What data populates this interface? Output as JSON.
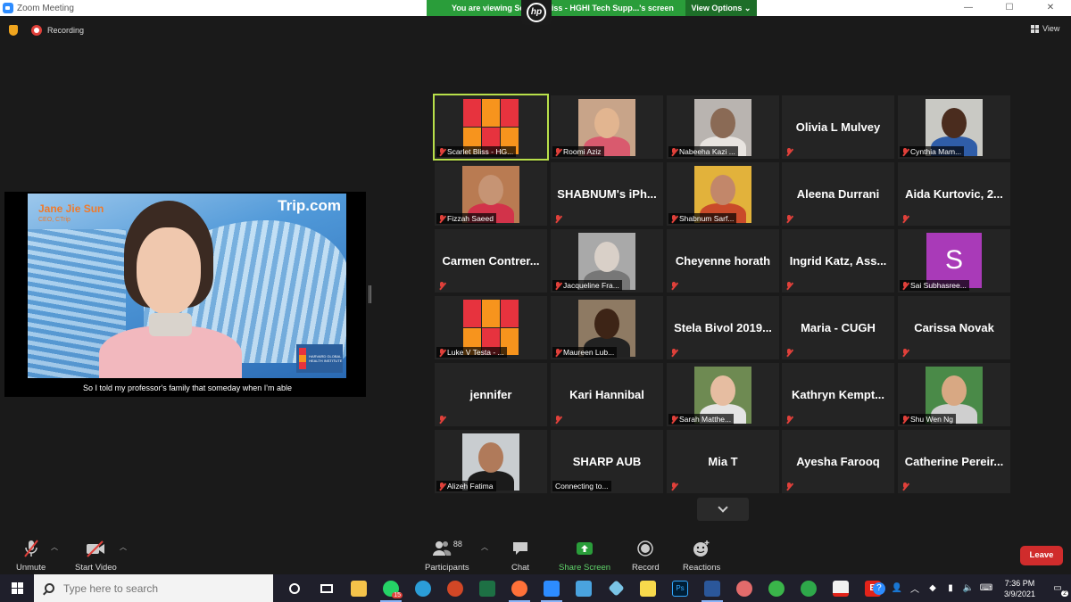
{
  "window": {
    "title": "Zoom Meeting"
  },
  "share_bar": {
    "message": "You are viewing Scarlet Bliss - HGHI Tech Supp...'s screen",
    "view_options": "View Options"
  },
  "window_controls": {
    "minimize": "—",
    "maximize": "☐",
    "close": "✕"
  },
  "recording": {
    "label": "Recording"
  },
  "view": {
    "label": "View"
  },
  "shared_screen": {
    "speaker_name": "Jane Jie Sun",
    "speaker_role": "CEO, CTrip",
    "brand": "Trip.com",
    "hghi_text": "HARVARD GLOBAL HEALTH INSTITUTE",
    "caption": "So I told my professor's family that someday when I'm able"
  },
  "participants": [
    {
      "name": "Scarlet Bliss - HG...",
      "kind": "logo",
      "active": true
    },
    {
      "name": "Roomi Aziz",
      "kind": "video",
      "bg": "#c8a489",
      "skin": "#e2b590",
      "top": "#d95a6e"
    },
    {
      "name": "Nabeeha Kazi ...",
      "kind": "video",
      "bg": "#b9b4b0",
      "skin": "#8a6a55",
      "top": "#e8e4e0"
    },
    {
      "name": "Olivia L Mulvey",
      "kind": "name"
    },
    {
      "name": "Cynthia Mam...",
      "kind": "video",
      "bg": "#c9c9c4",
      "skin": "#4a2c1e",
      "top": "#2f5da8"
    },
    {
      "name": "Fizzah Saeed",
      "kind": "video",
      "bg": "#b97b52",
      "skin": "#c69474",
      "top": "#d2334a"
    },
    {
      "name": "SHABNUM's iPh...",
      "kind": "name"
    },
    {
      "name": "Shabnum Sarf...",
      "kind": "video",
      "bg": "#e2b23b",
      "skin": "#c2876a",
      "top": "#c94a2a"
    },
    {
      "name": "Aleena Durrani",
      "kind": "name"
    },
    {
      "name": "Aida Kurtovic, 2...",
      "kind": "name"
    },
    {
      "name": "Carmen Contrer...",
      "kind": "name"
    },
    {
      "name": "Jacqueline Fra...",
      "kind": "video",
      "bg": "#a9a9a9",
      "skin": "#d9d0c8",
      "top": "#777777"
    },
    {
      "name": "Cheyenne horath",
      "kind": "name"
    },
    {
      "name": "Ingrid Katz, Ass...",
      "kind": "name"
    },
    {
      "name": "Sai Subhasree...",
      "kind": "avatar",
      "letter": "S"
    },
    {
      "name": "Luke V Testa - ...",
      "kind": "logo"
    },
    {
      "name": "Maureen Lub...",
      "kind": "video",
      "bg": "#8e7a63",
      "skin": "#3d2416",
      "top": "#222222"
    },
    {
      "name": "Stela Bivol 2019...",
      "kind": "name"
    },
    {
      "name": "Maria - CUGH",
      "kind": "name"
    },
    {
      "name": "Carissa Novak",
      "kind": "name"
    },
    {
      "name": "jennifer",
      "kind": "name"
    },
    {
      "name": "Kari Hannibal",
      "kind": "name"
    },
    {
      "name": "Sarah Matthe...",
      "kind": "video",
      "bg": "#6e8a52",
      "skin": "#e6bda1",
      "top": "#e4e4e4"
    },
    {
      "name": "Kathryn Kempt...",
      "kind": "name"
    },
    {
      "name": "Shu Wen Ng",
      "kind": "video",
      "bg": "#4a8a48",
      "skin": "#d8a883",
      "top": "#cfcfcf"
    },
    {
      "name": "Alizeh Fatima",
      "kind": "video",
      "bg": "#c9cdd0",
      "skin": "#b07a5a",
      "top": "#1b1b1b"
    },
    {
      "name": "SHARP AUB",
      "kind": "name",
      "status": "Connecting to..."
    },
    {
      "name": "Mia T",
      "kind": "name"
    },
    {
      "name": "Ayesha Farooq",
      "kind": "name"
    },
    {
      "name": "Catherine Pereir...",
      "kind": "name"
    }
  ],
  "toolbar": {
    "unmute": "Unmute",
    "start_video": "Start Video",
    "participants": "Participants",
    "participants_count": "88",
    "chat": "Chat",
    "share_screen": "Share Screen",
    "record": "Record",
    "reactions": "Reactions",
    "leave": "Leave"
  },
  "taskbar": {
    "search_placeholder": "Type here to search",
    "whatsapp_badge": "15",
    "time": "7:36 PM",
    "date": "3/9/2021",
    "notifications": "2"
  },
  "colors": {
    "share_green": "#2a9d3a",
    "active_border": "#b8e04a",
    "leave_red": "#d02c2c",
    "zoom_blue": "#2d8cff"
  }
}
